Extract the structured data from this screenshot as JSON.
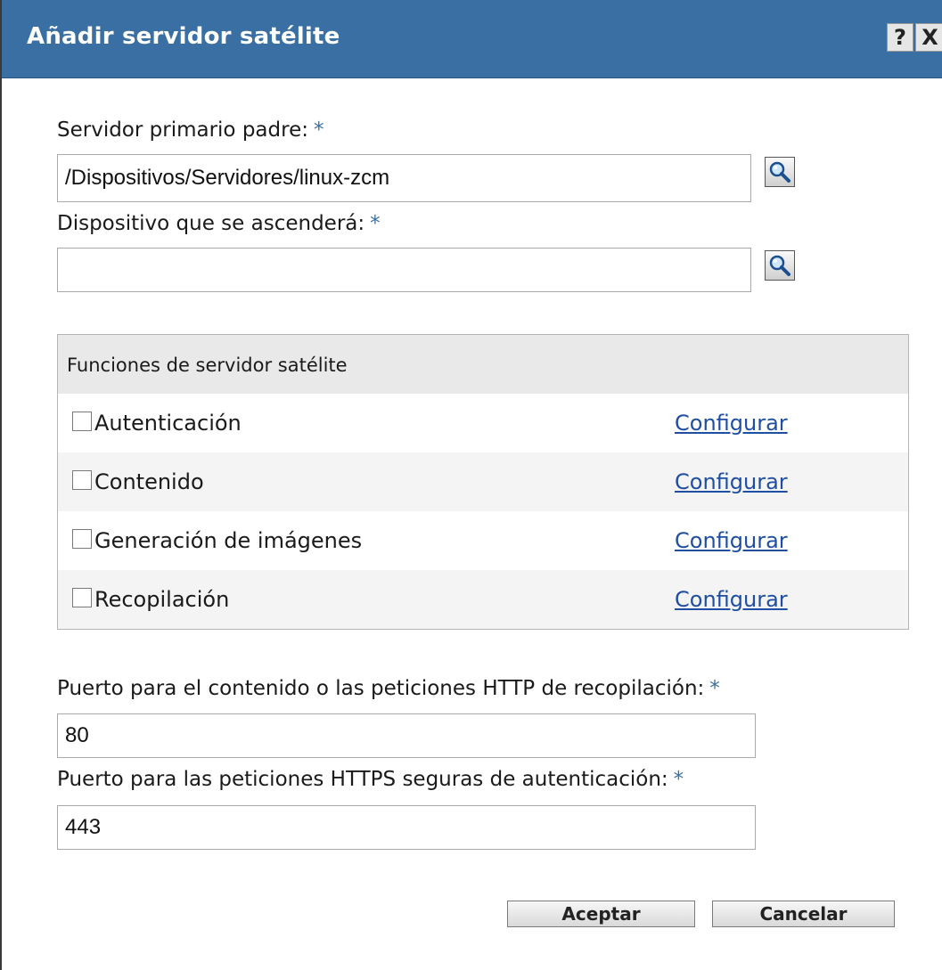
{
  "window": {
    "title": "Añadir servidor satélite",
    "help_label": "?",
    "close_label": "X"
  },
  "fields": {
    "required_marker": "*",
    "parent_server": {
      "label": "Servidor primario padre:",
      "value": "/Dispositivos/Servidores/linux-zcm"
    },
    "device": {
      "label": "Dispositivo que se ascenderá:",
      "value": ""
    },
    "http_port": {
      "label": "Puerto para el contenido o las peticiones HTTP de recopilación:",
      "value": "80"
    },
    "https_port": {
      "label": "Puerto para las peticiones HTTPS seguras de autenticación:",
      "value": "443"
    }
  },
  "roles": {
    "title": "Funciones de servidor satélite",
    "items": [
      {
        "label": "Autenticación",
        "checked": false,
        "link": "Configurar"
      },
      {
        "label": "Contenido",
        "checked": false,
        "link": "Configurar"
      },
      {
        "label": "Generación de imágenes",
        "checked": false,
        "link": "Configurar"
      },
      {
        "label": "Recopilación",
        "checked": false,
        "link": "Configurar"
      }
    ]
  },
  "buttons": {
    "ok": "Aceptar",
    "cancel": "Cancelar"
  },
  "icons": {
    "browse": "magnifier-icon"
  }
}
